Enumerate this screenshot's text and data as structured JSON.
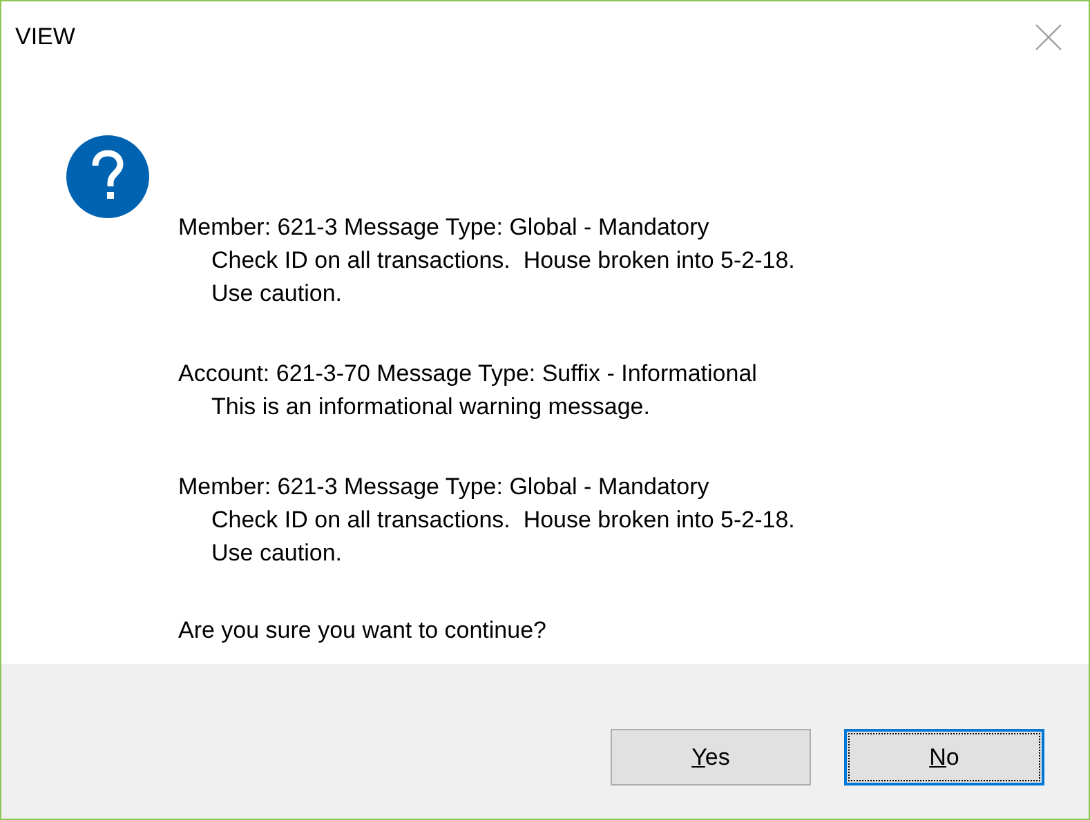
{
  "window": {
    "title": "VIEW"
  },
  "messages": [
    {
      "header": "Member: 621-3 Message Type: Global - Mandatory",
      "lines": [
        "Check ID on all transactions.  House broken into 5-2-18.",
        "Use caution."
      ]
    },
    {
      "header": "Account: 621-3-70 Message Type: Suffix - Informational",
      "lines": [
        "This is an informational warning message."
      ]
    },
    {
      "header": "Member: 621-3 Message Type: Global - Mandatory",
      "lines": [
        "Check ID on all transactions.  House broken into 5-2-18.",
        "Use caution."
      ]
    }
  ],
  "question": "Are you sure you want to continue?",
  "buttons": [
    {
      "mnemonic": "Y",
      "rest": "es",
      "focused": false
    },
    {
      "mnemonic": "N",
      "rest": "o",
      "focused": true
    }
  ]
}
